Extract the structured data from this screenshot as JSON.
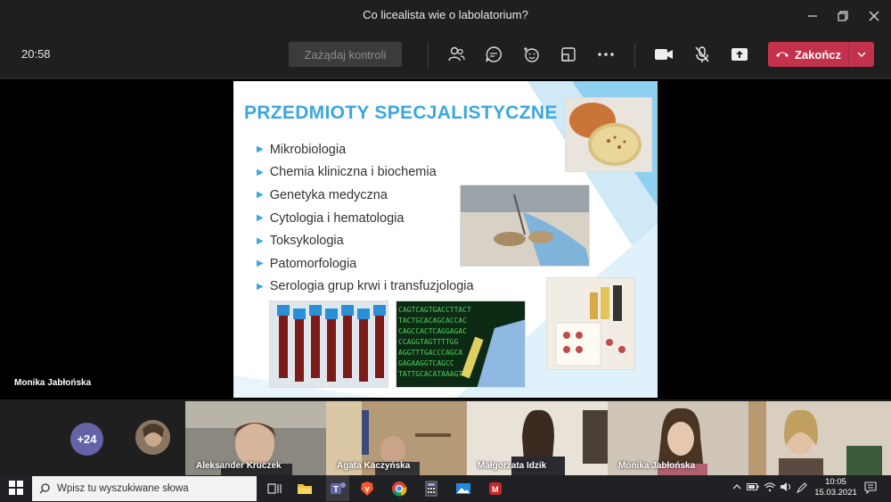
{
  "window": {
    "title": "Co licealista wie o labolatorium?"
  },
  "toolbar": {
    "timer": "20:58",
    "request_control": "Zażądaj kontroli",
    "end_call": "Zakończ"
  },
  "stage": {
    "presenter": "Monika Jabłońska"
  },
  "slide": {
    "title": "PRZEDMIOTY SPECJALISTYCZNE",
    "items": [
      "Mikrobiologia",
      "Chemia kliniczna i biochemia",
      "Genetyka medyczna",
      "Cytologia i hematologia",
      "Toksykologia",
      "Patomorfologia",
      "Serologia grup krwi i transfuzjologia"
    ]
  },
  "participants": {
    "more_count": "+24",
    "tiles": [
      {
        "name": "Aleksander Kruczek"
      },
      {
        "name": "Agata Kaczyńska"
      },
      {
        "name": "Małgorzata Idzik"
      },
      {
        "name": "Monika Jabłońska"
      },
      {
        "name": ""
      }
    ]
  },
  "taskbar": {
    "search_placeholder": "Wpisz tu wyszukiwane słowa",
    "time": "10:05",
    "date": "15.03.2021"
  },
  "colors": {
    "accent": "#6264a7",
    "end_call": "#c4314b",
    "slide_title": "#3aa7e0"
  }
}
